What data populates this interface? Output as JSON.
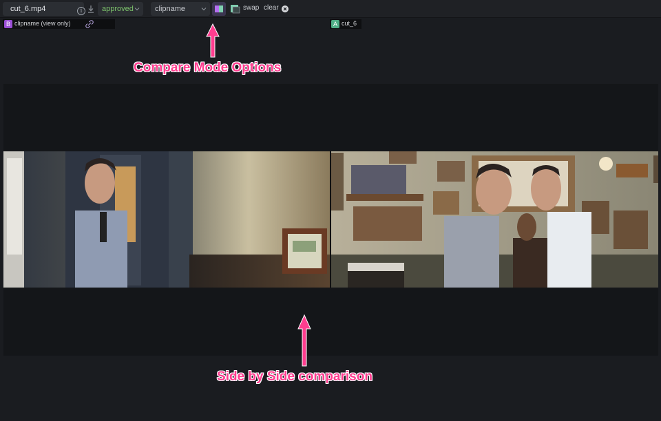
{
  "toolbar": {
    "file_name": "cut_6.mp4",
    "info_icon": "i",
    "status": "approved",
    "compare_clip": "clipname",
    "swap_label": "swap",
    "clear_label": "clear"
  },
  "clips": {
    "b": {
      "badge": "B",
      "label": "clipname (view only)",
      "color": "#9b4fd6"
    },
    "a": {
      "badge": "A",
      "label": "cut_6",
      "color": "#4fae86"
    }
  },
  "annotations": {
    "top": "Compare Mode Options",
    "bottom": "Side by Side comparison"
  },
  "colors": {
    "accent": "#ff3d8f",
    "status_green": "#7cc26b"
  },
  "icons": [
    "info-icon",
    "download-icon",
    "chevron-down-icon",
    "side-by-side-icon",
    "overlay-icon",
    "clear-x-icon",
    "link-icon",
    "arrow-up-icon"
  ]
}
